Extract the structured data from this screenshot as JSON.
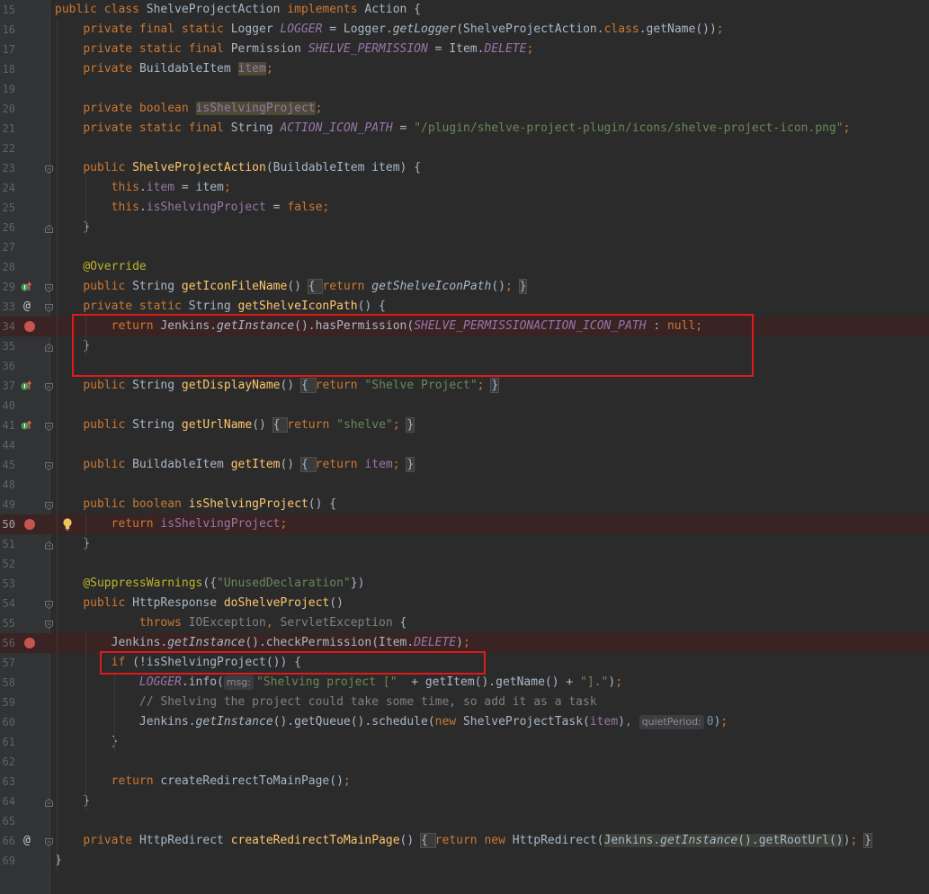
{
  "editor": {
    "lines": [
      {
        "n": "15",
        "tokens": [
          [
            "kw",
            "public class "
          ],
          [
            "",
            "ShelveProjectAction "
          ],
          [
            "kw",
            "implements "
          ],
          [
            "",
            "Action {"
          ]
        ]
      },
      {
        "n": "16",
        "tokens": [
          [
            "",
            "    "
          ],
          [
            "kw",
            "private final static "
          ],
          [
            "",
            "Logger "
          ],
          [
            "sfld",
            "LOGGER"
          ],
          [
            "",
            " = Logger."
          ],
          [
            "it",
            "getLogger"
          ],
          [
            "",
            "(ShelveProjectAction."
          ],
          [
            "kw",
            "class"
          ],
          [
            "",
            ".getName())"
          ],
          [
            "kw",
            ";"
          ]
        ]
      },
      {
        "n": "17",
        "tokens": [
          [
            "",
            "    "
          ],
          [
            "kw",
            "private static final "
          ],
          [
            "",
            "Permission "
          ],
          [
            "sfld",
            "SHELVE_PERMISSION"
          ],
          [
            "",
            " = Item."
          ],
          [
            "sfld",
            "DELETE"
          ],
          [
            "kw",
            ";"
          ]
        ]
      },
      {
        "n": "18",
        "tokens": [
          [
            "",
            "    "
          ],
          [
            "kw",
            "private "
          ],
          [
            "",
            "BuildableItem "
          ],
          [
            "fld hlu",
            "item"
          ],
          [
            "kw",
            ";"
          ]
        ]
      },
      {
        "n": "19",
        "tokens": []
      },
      {
        "n": "20",
        "tokens": [
          [
            "",
            "    "
          ],
          [
            "kw",
            "private boolean "
          ],
          [
            "fld hlu",
            "isShelvingProject"
          ],
          [
            "kw",
            ";"
          ]
        ]
      },
      {
        "n": "21",
        "tokens": [
          [
            "",
            "    "
          ],
          [
            "kw",
            "private static final "
          ],
          [
            "",
            "String "
          ],
          [
            "sfld",
            "ACTION_ICON_PATH"
          ],
          [
            "",
            " = "
          ],
          [
            "str",
            "\"/plugin/shelve-project-plugin/icons/shelve-project-icon.png\""
          ],
          [
            "kw",
            ";"
          ]
        ]
      },
      {
        "n": "22",
        "tokens": []
      },
      {
        "n": "23",
        "tokens": [
          [
            "",
            "    "
          ],
          [
            "kw",
            "public "
          ],
          [
            "fn",
            "ShelveProjectAction"
          ],
          [
            "",
            "(BuildableItem item) {"
          ]
        ]
      },
      {
        "n": "24",
        "tokens": [
          [
            "",
            "        "
          ],
          [
            "kw",
            "this"
          ],
          [
            "",
            "."
          ],
          [
            "fld",
            "item"
          ],
          [
            "",
            " = item"
          ],
          [
            "kw",
            ";"
          ]
        ]
      },
      {
        "n": "25",
        "tokens": [
          [
            "",
            "        "
          ],
          [
            "kw",
            "this"
          ],
          [
            "",
            "."
          ],
          [
            "fld",
            "isShelvingProject"
          ],
          [
            "",
            " = "
          ],
          [
            "kw",
            "false;"
          ]
        ]
      },
      {
        "n": "26",
        "tokens": [
          [
            "",
            "    }"
          ]
        ]
      },
      {
        "n": "27",
        "tokens": []
      },
      {
        "n": "28",
        "tokens": [
          [
            "",
            "    "
          ],
          [
            "ann",
            "@Override"
          ]
        ]
      },
      {
        "n": "29",
        "tokens": [
          [
            "",
            "    "
          ],
          [
            "kw",
            "public "
          ],
          [
            "",
            "String "
          ],
          [
            "fn",
            "getIconFileName"
          ],
          [
            "",
            "() "
          ],
          [
            "fb",
            "{ "
          ],
          [
            "kw",
            "return "
          ],
          [
            "it",
            "getShelveIconPath"
          ],
          [
            "",
            "()"
          ],
          [
            "kw",
            "; "
          ],
          [
            "fb",
            "}"
          ]
        ]
      },
      {
        "n": "33",
        "tokens": [
          [
            "",
            "    "
          ],
          [
            "kw",
            "private static "
          ],
          [
            "",
            "String "
          ],
          [
            "fn",
            "getShelveIconPath"
          ],
          [
            "",
            "() {"
          ]
        ]
      },
      {
        "n": "34",
        "tokens": [
          [
            "",
            "        "
          ],
          [
            "kw",
            "return "
          ],
          [
            "",
            "Jenkins."
          ],
          [
            "it",
            "getInstance"
          ],
          [
            "",
            "().hasPermission("
          ],
          [
            "sfld",
            "SHELVE_PERMISSION"
          ],
          [
            ") ? "
          ],
          [
            "sfld",
            "ACTION_ICON_PATH"
          ],
          [
            "",
            " : "
          ],
          [
            "kw",
            "null;"
          ]
        ]
      },
      {
        "n": "35",
        "tokens": [
          [
            "",
            "    }"
          ]
        ]
      },
      {
        "n": "36",
        "tokens": []
      },
      {
        "n": "37",
        "tokens": [
          [
            "",
            "    "
          ],
          [
            "kw",
            "public "
          ],
          [
            "",
            "String "
          ],
          [
            "fn",
            "getDisplayName"
          ],
          [
            "",
            "() "
          ],
          [
            "fb",
            "{ "
          ],
          [
            "kw",
            "return "
          ],
          [
            "str",
            "\"Shelve Project\""
          ],
          [
            "kw",
            "; "
          ],
          [
            "fb",
            "}"
          ]
        ]
      },
      {
        "n": "40",
        "tokens": []
      },
      {
        "n": "41",
        "tokens": [
          [
            "",
            "    "
          ],
          [
            "kw",
            "public "
          ],
          [
            "",
            "String "
          ],
          [
            "fn",
            "getUrlName"
          ],
          [
            "",
            "() "
          ],
          [
            "fb",
            "{ "
          ],
          [
            "kw",
            "return "
          ],
          [
            "str",
            "\"shelve\""
          ],
          [
            "kw",
            "; "
          ],
          [
            "fb",
            "}"
          ]
        ]
      },
      {
        "n": "44",
        "tokens": []
      },
      {
        "n": "45",
        "tokens": [
          [
            "",
            "    "
          ],
          [
            "kw",
            "public "
          ],
          [
            "",
            "BuildableItem "
          ],
          [
            "fn",
            "getItem"
          ],
          [
            "",
            "() "
          ],
          [
            "fb",
            "{ "
          ],
          [
            "kw",
            "return "
          ],
          [
            "fld",
            "item"
          ],
          [
            "kw",
            "; "
          ],
          [
            "fb",
            "}"
          ]
        ]
      },
      {
        "n": "48",
        "tokens": []
      },
      {
        "n": "49",
        "tokens": [
          [
            "",
            "    "
          ],
          [
            "kw",
            "public boolean "
          ],
          [
            "fn",
            "isShelvingProject"
          ],
          [
            "",
            "() {"
          ]
        ]
      },
      {
        "n": "50",
        "tokens": [
          [
            "",
            "        "
          ],
          [
            "kw",
            "return "
          ],
          [
            "fld",
            "isShelvingProject"
          ],
          [
            "kw",
            ";"
          ]
        ]
      },
      {
        "n": "51",
        "tokens": [
          [
            "",
            "    }"
          ]
        ]
      },
      {
        "n": "52",
        "tokens": []
      },
      {
        "n": "53",
        "tokens": [
          [
            "",
            "    "
          ],
          [
            "ann",
            "@SuppressWarnings"
          ],
          [
            "",
            "({"
          ],
          [
            "str",
            "\"UnusedDeclaration\""
          ],
          [
            "",
            "})"
          ]
        ]
      },
      {
        "n": "54",
        "tokens": [
          [
            "",
            "    "
          ],
          [
            "kw",
            "public "
          ],
          [
            "",
            "HttpResponse "
          ],
          [
            "fn",
            "doShelveProject"
          ],
          [
            "",
            "()"
          ]
        ]
      },
      {
        "n": "55",
        "tokens": [
          [
            "",
            "            "
          ],
          [
            "kw",
            "throws "
          ],
          [
            "cmt",
            "IOException"
          ],
          [
            "kw",
            ", "
          ],
          [
            "cmt",
            "ServletException "
          ],
          [
            "",
            "{"
          ]
        ]
      },
      {
        "n": "56",
        "tokens": [
          [
            "",
            "        Jenkins."
          ],
          [
            "it",
            "getInstance"
          ],
          [
            "",
            "().checkPermission(Item."
          ],
          [
            "sfld",
            "DELETE"
          ],
          [
            "",
            ")"
          ],
          [
            "kw",
            ";"
          ]
        ]
      },
      {
        "n": "57",
        "tokens": [
          [
            "",
            "        "
          ],
          [
            "kw",
            "if "
          ],
          [
            "",
            "(!isShelvingProject()) {"
          ]
        ]
      },
      {
        "n": "58",
        "tokens": [
          [
            "",
            "            "
          ],
          [
            "sfld",
            "LOGGER"
          ],
          [
            "",
            ".info("
          ],
          [
            "hint",
            "msg:"
          ],
          [
            "str",
            "\"Shelving project [\" "
          ],
          [
            "",
            " + getItem().getName() + "
          ],
          [
            "str",
            "\"].\""
          ],
          [
            "",
            ")"
          ],
          [
            "kw",
            ";"
          ]
        ]
      },
      {
        "n": "59",
        "tokens": [
          [
            "",
            "            "
          ],
          [
            "cmt",
            "// Shelving the project could take some time, so add it as a task"
          ]
        ]
      },
      {
        "n": "60",
        "tokens": [
          [
            "",
            "            Jenkins."
          ],
          [
            "it",
            "getInstance"
          ],
          [
            "",
            "().getQueue().schedule("
          ],
          [
            "kw",
            "new "
          ],
          [
            "",
            "ShelveProjectTask("
          ],
          [
            "fld",
            "item"
          ],
          [
            "",
            ")"
          ],
          [
            "kw",
            ", "
          ],
          [
            "hint",
            "quietPeriod:"
          ],
          [
            "num",
            "0"
          ],
          [
            "",
            ")"
          ],
          [
            "kw",
            ";"
          ]
        ]
      },
      {
        "n": "61",
        "tokens": [
          [
            "",
            "        }"
          ]
        ]
      },
      {
        "n": "62",
        "tokens": []
      },
      {
        "n": "63",
        "tokens": [
          [
            "",
            "        "
          ],
          [
            "kw",
            "return "
          ],
          [
            "",
            "createRedirectToMainPage()"
          ],
          [
            "kw",
            ";"
          ]
        ]
      },
      {
        "n": "64",
        "tokens": [
          [
            "",
            "    }"
          ]
        ]
      },
      {
        "n": "65",
        "tokens": []
      },
      {
        "n": "66",
        "tokens": [
          [
            "",
            "    "
          ],
          [
            "kw",
            "private "
          ],
          [
            "",
            "HttpRedirect "
          ],
          [
            "fn",
            "createRedirectToMainPage"
          ],
          [
            "",
            "() "
          ],
          [
            "fb",
            "{ "
          ],
          [
            "kw",
            "return new "
          ],
          [
            "",
            "HttpRedirect("
          ],
          [
            "hl",
            "Jenkins."
          ],
          [
            "hl it",
            "getInstance"
          ],
          [
            "hl",
            "().getRootUrl()"
          ],
          [
            "",
            ")"
          ],
          [
            "kw",
            "; "
          ],
          [
            "fb",
            "}"
          ]
        ]
      },
      {
        "n": "69",
        "tokens": [
          [
            "",
            "}"
          ]
        ]
      }
    ]
  },
  "gutter": {
    "breakpoint_lines": [
      "34",
      "50",
      "56"
    ],
    "at_lines": [
      "33",
      "66"
    ],
    "override_lines": [
      "29",
      "37",
      "41"
    ],
    "bulb_line": "50",
    "current_line": "50"
  },
  "colors": {
    "breakpoint": "#c75450",
    "highlight_box": "#e0191b",
    "background": "#2b2b2b"
  }
}
